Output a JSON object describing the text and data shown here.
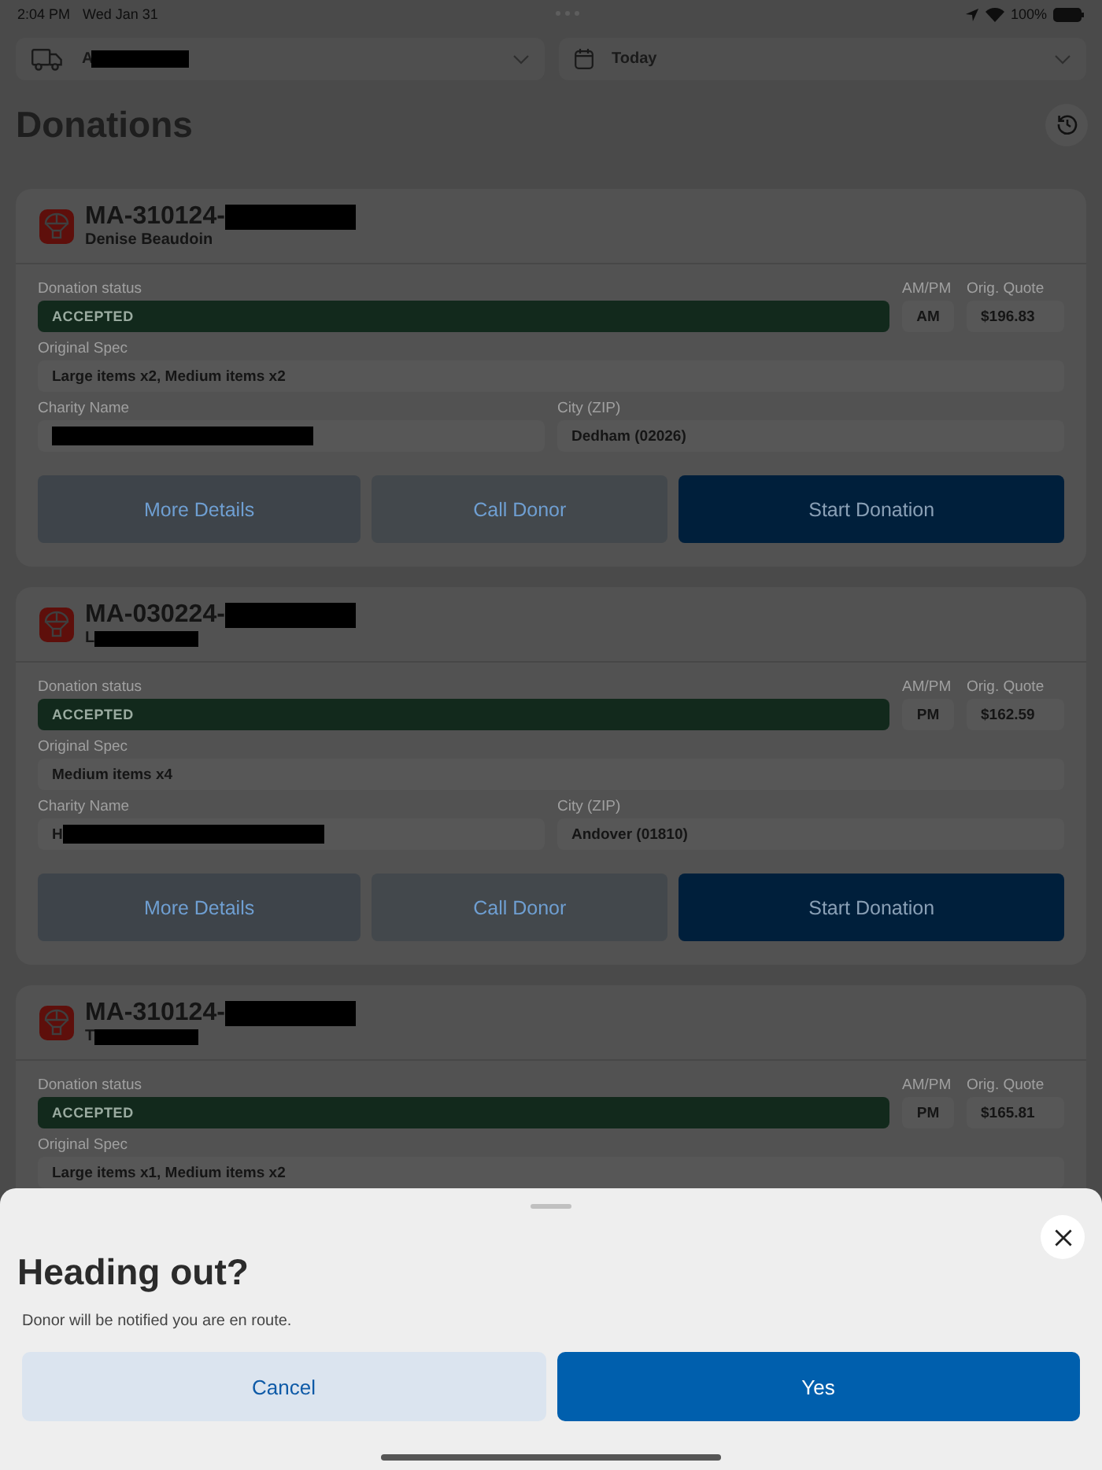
{
  "status_bar": {
    "time": "2:04 PM",
    "date": "Wed Jan 31",
    "battery": "100%"
  },
  "filters": [
    {
      "kind": "truck",
      "value": "A",
      "redacted": true
    },
    {
      "kind": "calendar",
      "value": "Today",
      "redacted": false
    }
  ],
  "title": "Donations",
  "donations": [
    {
      "id": "MA-310124-",
      "id_redacted": true,
      "donor": "Denise Beaudoin",
      "donor_redacted": false,
      "status_label": "Donation status",
      "status": "ACCEPTED",
      "ampm_label": "AM/PM",
      "ampm": "AM",
      "quote_label": "Orig. Quote",
      "quote": "$196.83",
      "spec_label": "Original Spec",
      "spec": "Large items x2, Medium items x2",
      "charity_label": "Charity Name",
      "charity_redacted": true,
      "city_label": "City (ZIP)",
      "city": "Dedham (02026)",
      "actions": [
        {
          "label": "More Details",
          "kind": "secondary"
        },
        {
          "label": "Call Donor",
          "kind": "tertiary"
        },
        {
          "label": "Start Donation",
          "kind": "primary"
        }
      ]
    },
    {
      "id": "MA-030224-",
      "id_redacted": true,
      "donor": "L",
      "donor_redacted": true,
      "status_label": "Donation status",
      "status": "ACCEPTED",
      "ampm_label": "AM/PM",
      "ampm": "PM",
      "quote_label": "Orig. Quote",
      "quote": "$162.59",
      "spec_label": "Original Spec",
      "spec": "Medium items x4",
      "charity_label": "Charity Name",
      "charity": "H",
      "charity_redacted": true,
      "city_label": "City (ZIP)",
      "city": "Andover (01810)",
      "actions": [
        {
          "label": "More Details",
          "kind": "secondary"
        },
        {
          "label": "Call Donor",
          "kind": "tertiary"
        },
        {
          "label": "Start Donation",
          "kind": "primary"
        }
      ]
    },
    {
      "id": "MA-310124-",
      "id_redacted": true,
      "donor": "T",
      "donor_redacted": true,
      "status_label": "Donation status",
      "status": "ACCEPTED",
      "ampm_label": "AM/PM",
      "ampm": "PM",
      "quote_label": "Orig. Quote",
      "quote": "$165.81",
      "spec_label": "Original Spec",
      "spec": "Large items x1, Medium items x2"
    }
  ],
  "sheet": {
    "title": "Heading out?",
    "message": "Donor will be notified you are en route.",
    "buttons": [
      {
        "label": "Cancel",
        "kind": "secondary"
      },
      {
        "label": "Yes",
        "kind": "primary"
      }
    ]
  }
}
